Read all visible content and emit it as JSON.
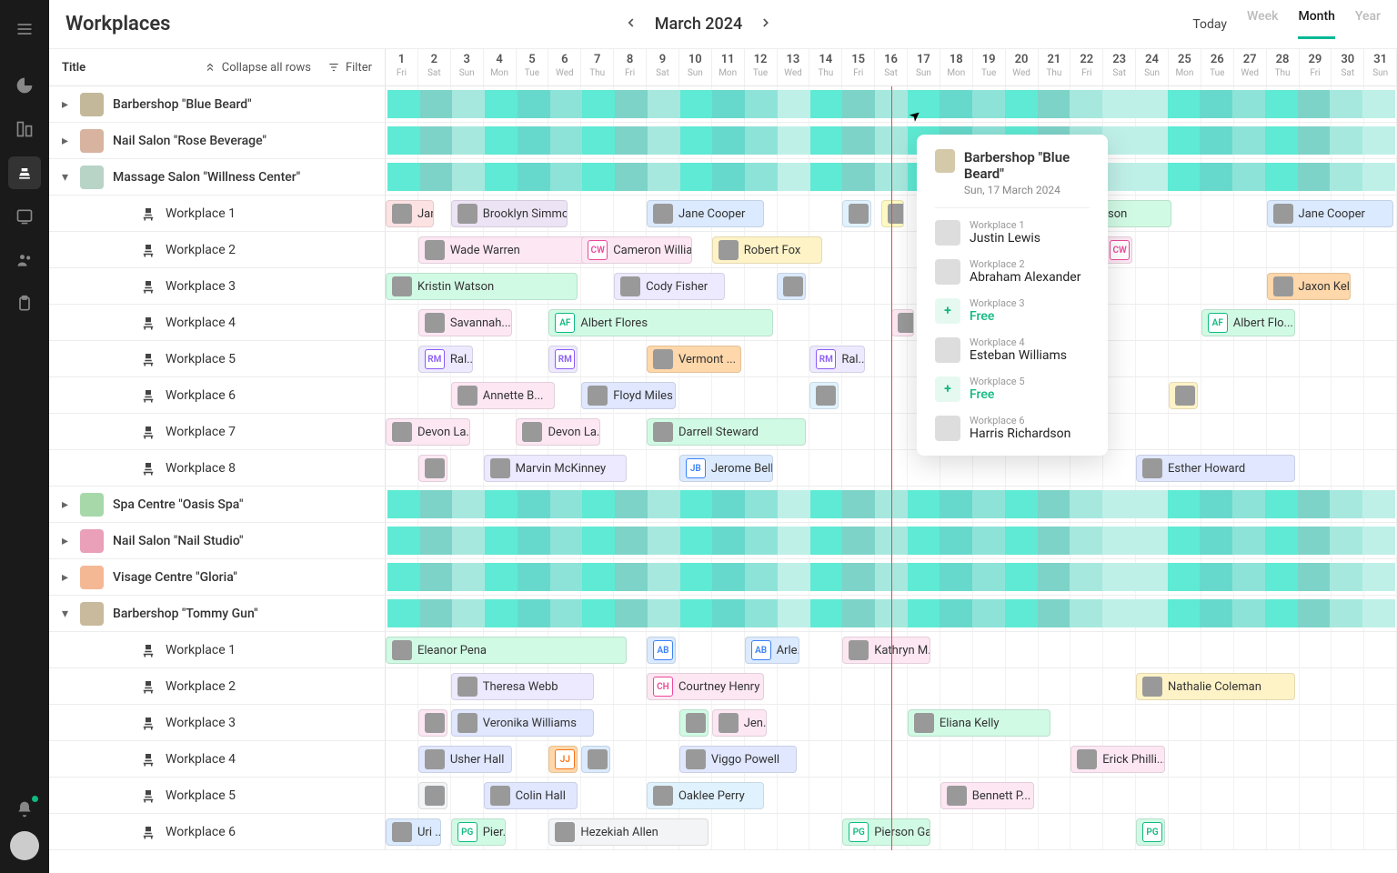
{
  "header": {
    "page_title": "Workplaces",
    "date_label": "March 2024",
    "today": "Today",
    "views": {
      "week": "Week",
      "month": "Month",
      "year": "Year"
    },
    "active_view": "month"
  },
  "columns": {
    "title_label": "Title",
    "collapse_label": "Collapse all rows",
    "filter_label": "Filter"
  },
  "days": [
    {
      "n": "1",
      "d": "Fri"
    },
    {
      "n": "2",
      "d": "Sat"
    },
    {
      "n": "3",
      "d": "Sun"
    },
    {
      "n": "4",
      "d": "Mon"
    },
    {
      "n": "5",
      "d": "Tue"
    },
    {
      "n": "6",
      "d": "Wed"
    },
    {
      "n": "7",
      "d": "Thu"
    },
    {
      "n": "8",
      "d": "Fri"
    },
    {
      "n": "9",
      "d": "Sat"
    },
    {
      "n": "10",
      "d": "Sun"
    },
    {
      "n": "11",
      "d": "Mon"
    },
    {
      "n": "12",
      "d": "Tue"
    },
    {
      "n": "13",
      "d": "Wed"
    },
    {
      "n": "14",
      "d": "Thu"
    },
    {
      "n": "15",
      "d": "Fri"
    },
    {
      "n": "16",
      "d": "Sat"
    },
    {
      "n": "17",
      "d": "Sun"
    },
    {
      "n": "18",
      "d": "Mon"
    },
    {
      "n": "19",
      "d": "Tue"
    },
    {
      "n": "20",
      "d": "Wed"
    },
    {
      "n": "21",
      "d": "Thu"
    },
    {
      "n": "22",
      "d": "Fri"
    },
    {
      "n": "23",
      "d": "Sat"
    },
    {
      "n": "24",
      "d": "Sun"
    },
    {
      "n": "25",
      "d": "Mon"
    },
    {
      "n": "26",
      "d": "Tue"
    },
    {
      "n": "27",
      "d": "Wed"
    },
    {
      "n": "28",
      "d": "Thu"
    },
    {
      "n": "29",
      "d": "Fri"
    },
    {
      "n": "30",
      "d": "Sat"
    },
    {
      "n": "31",
      "d": "Sun"
    }
  ],
  "current_day_index": 15,
  "groups": [
    {
      "label": "Barbershop \"Blue Beard\"",
      "expanded": false,
      "icon": "#c4b89a",
      "children": []
    },
    {
      "label": "Nail Salon \"Rose Beverage\"",
      "expanded": false,
      "icon": "#d8b4a0",
      "children": []
    },
    {
      "label": "Massage Salon \"Willness Center\"",
      "expanded": true,
      "icon": "#b8d4c7",
      "children": [
        {
          "label": "Workplace 1",
          "events": [
            {
              "start": 0,
              "span": 1.6,
              "name": "Jan...",
              "color": "#fde2e4",
              "av": true
            },
            {
              "start": 2,
              "span": 3.7,
              "name": "Brooklyn Simmo...",
              "color": "#ece4f5",
              "av": true
            },
            {
              "start": 8,
              "span": 3.7,
              "name": "Jane Cooper",
              "color": "#dbeafe",
              "av": true
            },
            {
              "start": 14,
              "span": 1,
              "name": "",
              "color": "#e0f2fe",
              "av": true
            },
            {
              "start": 15.2,
              "span": 0.8,
              "name": "",
              "color": "#fef9c3",
              "av": true
            },
            {
              "start": 20,
              "span": 4.2,
              "name": "nny Wilson",
              "color": "#d1fae5",
              "av": true
            },
            {
              "start": 27,
              "span": 4,
              "name": "Jane Cooper",
              "color": "#dbeafe",
              "av": true
            }
          ]
        },
        {
          "label": "Workplace 2",
          "events": [
            {
              "start": 1,
              "span": 6,
              "name": "Wade Warren",
              "color": "#fce7f3",
              "av": true
            },
            {
              "start": 6,
              "span": 3.5,
              "name": "Cameron William...",
              "color": "#fce7f3",
              "ini": "CW",
              "iniColor": "#ec4899"
            },
            {
              "start": 10,
              "span": 3.5,
              "name": "Robert Fox",
              "color": "#fef3c7",
              "av": true
            },
            {
              "start": 22,
              "span": 1,
              "name": "",
              "color": "#fce7f3",
              "ini": "CW",
              "iniColor": "#ec4899"
            }
          ]
        },
        {
          "label": "Workplace 3",
          "events": [
            {
              "start": 0,
              "span": 6,
              "name": "Kristin Watson",
              "color": "#d1fae5",
              "av": true
            },
            {
              "start": 7,
              "span": 3.5,
              "name": "Cody Fisher",
              "color": "#ede9fe",
              "av": true
            },
            {
              "start": 12,
              "span": 1,
              "name": "",
              "color": "#dbeafe",
              "av": true
            },
            {
              "start": 27,
              "span": 2.7,
              "name": "Jaxon Kelly",
              "color": "#fed7aa",
              "av": true
            }
          ]
        },
        {
          "label": "Workplace 4",
          "events": [
            {
              "start": 1,
              "span": 3,
              "name": "Savannah...",
              "color": "#fce7f3",
              "av": true
            },
            {
              "start": 5,
              "span": 7,
              "name": "Albert Flores",
              "color": "#d1fae5",
              "ini": "AF",
              "iniColor": "#10b981"
            },
            {
              "start": 15.5,
              "span": 0.8,
              "name": "",
              "color": "#fce7f3",
              "av": true
            },
            {
              "start": 25,
              "span": 3,
              "name": "Albert Flo...",
              "color": "#d1fae5",
              "ini": "AF",
              "iniColor": "#10b981"
            }
          ]
        },
        {
          "label": "Workplace 5",
          "events": [
            {
              "start": 1,
              "span": 1.8,
              "name": "Ral...",
              "color": "#ede9fe",
              "ini": "RM",
              "iniColor": "#8b5cf6"
            },
            {
              "start": 5,
              "span": 1,
              "name": "",
              "color": "#ede9fe",
              "ini": "RM",
              "iniColor": "#8b5cf6"
            },
            {
              "start": 8,
              "span": 3,
              "name": "Vermont ...",
              "color": "#fed7aa",
              "av": true
            },
            {
              "start": 13,
              "span": 1.8,
              "name": "Ral...",
              "color": "#ede9fe",
              "ini": "RM",
              "iniColor": "#8b5cf6"
            }
          ]
        },
        {
          "label": "Workplace 6",
          "events": [
            {
              "start": 2,
              "span": 3.3,
              "name": "Annette B...",
              "color": "#fce7f3",
              "av": true
            },
            {
              "start": 6,
              "span": 3,
              "name": "Floyd Miles",
              "color": "#e0e7ff",
              "av": true
            },
            {
              "start": 13,
              "span": 1,
              "name": "",
              "color": "#e0f2fe",
              "av": true
            },
            {
              "start": 24,
              "span": 1,
              "name": "",
              "color": "#fef3c7",
              "av": true
            }
          ]
        },
        {
          "label": "Workplace 7",
          "events": [
            {
              "start": 0,
              "span": 2.7,
              "name": "Devon La...",
              "color": "#fce7f3",
              "av": true
            },
            {
              "start": 4,
              "span": 2.7,
              "name": "Devon La...",
              "color": "#fce7f3",
              "av": true
            },
            {
              "start": 8,
              "span": 5,
              "name": "Darrell Steward",
              "color": "#d1fae5",
              "av": true
            }
          ]
        },
        {
          "label": "Workplace 8",
          "events": [
            {
              "start": 1,
              "span": 1,
              "name": "",
              "color": "#fce7f3",
              "av": true
            },
            {
              "start": 3,
              "span": 4.5,
              "name": "Marvin McKinney",
              "color": "#ede9fe",
              "av": true
            },
            {
              "start": 9,
              "span": 3,
              "name": "Jerome Bell",
              "color": "#dbeafe",
              "ini": "JB",
              "iniColor": "#3b82f6"
            },
            {
              "start": 23,
              "span": 5,
              "name": "Esther Howard",
              "color": "#e0e7ff",
              "av": true
            }
          ]
        }
      ]
    },
    {
      "label": "Spa Centre \"Oasis Spa\"",
      "expanded": false,
      "icon": "#a7d8a9",
      "children": []
    },
    {
      "label": "Nail Salon \"Nail Studio\"",
      "expanded": false,
      "icon": "#e9a0b8",
      "children": []
    },
    {
      "label": "Visage Centre \"Gloria\"",
      "expanded": false,
      "icon": "#f5b895",
      "children": []
    },
    {
      "label": "Barbershop \"Tommy Gun\"",
      "expanded": true,
      "icon": "#c9b99d",
      "children": [
        {
          "label": "Workplace 1",
          "events": [
            {
              "start": 0,
              "span": 7.5,
              "name": "Eleanor Pena",
              "color": "#d1fae5",
              "av": true
            },
            {
              "start": 8,
              "span": 1,
              "name": "",
              "color": "#dbeafe",
              "ini": "AB",
              "iniColor": "#3b82f6"
            },
            {
              "start": 11,
              "span": 1.8,
              "name": "Arle...",
              "color": "#dbeafe",
              "ini": "AB",
              "iniColor": "#3b82f6"
            },
            {
              "start": 14,
              "span": 2.8,
              "name": "Kathryn M...",
              "color": "#fce7f3",
              "av": true
            }
          ]
        },
        {
          "label": "Workplace 2",
          "events": [
            {
              "start": 2,
              "span": 4.5,
              "name": "Theresa Webb",
              "color": "#ede9fe",
              "av": true
            },
            {
              "start": 8,
              "span": 3.7,
              "name": "Courtney Henry",
              "color": "#fce7f3",
              "ini": "CH",
              "iniColor": "#ec4899"
            },
            {
              "start": 23,
              "span": 5,
              "name": "Nathalie Coleman",
              "color": "#fef3c7",
              "av": true
            }
          ]
        },
        {
          "label": "Workplace 3",
          "events": [
            {
              "start": 1,
              "span": 1,
              "name": "",
              "color": "#fce7f3",
              "av": true
            },
            {
              "start": 2,
              "span": 4.5,
              "name": "Veronika Williams",
              "color": "#e0e7ff",
              "av": true
            },
            {
              "start": 9,
              "span": 1,
              "name": "",
              "color": "#d1fae5",
              "av": true
            },
            {
              "start": 10,
              "span": 1.8,
              "name": "Jen...",
              "color": "#fce7f3",
              "av": true
            },
            {
              "start": 16,
              "span": 4.5,
              "name": "Eliana Kelly",
              "color": "#d1fae5",
              "av": true
            }
          ]
        },
        {
          "label": "Workplace 4",
          "events": [
            {
              "start": 1,
              "span": 3,
              "name": "Usher Hall",
              "color": "#e0e7ff",
              "av": true
            },
            {
              "start": 5,
              "span": 1,
              "name": "",
              "color": "#fed7aa",
              "ini": "JJ",
              "iniColor": "#f97316"
            },
            {
              "start": 6,
              "span": 1,
              "name": "",
              "color": "#dbeafe",
              "av": true
            },
            {
              "start": 9,
              "span": 3.7,
              "name": "Viggo Powell",
              "color": "#e0e7ff",
              "av": true
            },
            {
              "start": 21,
              "span": 3,
              "name": "Erick Philli...",
              "color": "#fce7f3",
              "av": true
            }
          ]
        },
        {
          "label": "Workplace 5",
          "events": [
            {
              "start": 1,
              "span": 1,
              "name": "",
              "color": "#f3f4f6",
              "av": true
            },
            {
              "start": 3,
              "span": 3,
              "name": "Colin Hall",
              "color": "#e0e7ff",
              "av": true
            },
            {
              "start": 8,
              "span": 3.7,
              "name": "Oaklee Perry",
              "color": "#e0f2fe",
              "av": true
            },
            {
              "start": 17,
              "span": 3,
              "name": "Bennett P...",
              "color": "#fce7f3",
              "av": true
            }
          ]
        },
        {
          "label": "Workplace 6",
          "events": [
            {
              "start": 0,
              "span": 1.8,
              "name": "Uri ...",
              "color": "#dbeafe",
              "av": true
            },
            {
              "start": 2,
              "span": 1.8,
              "name": "Pier...",
              "color": "#d1fae5",
              "ini": "PG",
              "iniColor": "#10b981"
            },
            {
              "start": 5,
              "span": 5,
              "name": "Hezekiah Allen",
              "color": "#f3f4f6",
              "av": true
            },
            {
              "start": 14,
              "span": 2.8,
              "name": "Pierson Ga...",
              "color": "#d1fae5",
              "ini": "PG",
              "iniColor": "#10b981"
            },
            {
              "start": 23,
              "span": 1,
              "name": "",
              "color": "#d1fae5",
              "ini": "PG",
              "iniColor": "#10b981"
            }
          ]
        }
      ]
    }
  ],
  "heat_colors": [
    "#5eead4",
    "#7dd3c8",
    "#a7e8de",
    "#5eead4",
    "#67d9cc",
    "#8ee3d8",
    "#5eead4",
    "#7dd3c8",
    "#a7e8de",
    "#5eead4",
    "#67d9cc",
    "#8ee3d8",
    "#bff0e8",
    "#5eead4",
    "#7dd3c8",
    "#a7e8de",
    "#5eead4",
    "#67d9cc",
    "#8ee3d8",
    "#5eead4",
    "#7dd3c8",
    "#a7e8de",
    "#bff0e8",
    "#bff0e8",
    "#5eead4",
    "#67d9cc",
    "#8ee3d8",
    "#5eead4",
    "#7dd3c8",
    "#a7e8de",
    "#bff0e8"
  ],
  "tooltip": {
    "title": "Barbershop \"Blue Beard\"",
    "subtitle": "Sun, 17 March 2024",
    "rows": [
      {
        "label": "Workplace 1",
        "value": "Justin Lewis",
        "free": false
      },
      {
        "label": "Workplace 2",
        "value": "Abraham Alexander",
        "free": false
      },
      {
        "label": "Workplace 3",
        "value": "Free",
        "free": true
      },
      {
        "label": "Workplace 4",
        "value": "Esteban Williams",
        "free": false
      },
      {
        "label": "Workplace 5",
        "value": "Free",
        "free": true
      },
      {
        "label": "Workplace 6",
        "value": "Harris Richardson",
        "free": false
      }
    ]
  }
}
